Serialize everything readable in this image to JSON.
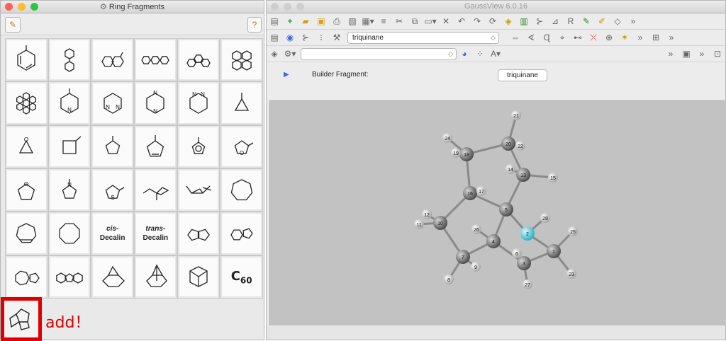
{
  "ring_window": {
    "title": "Ring Fragments",
    "tiles": [
      {
        "name": "benzene"
      },
      {
        "name": "biphenyl"
      },
      {
        "name": "naphthalene"
      },
      {
        "name": "anthracene"
      },
      {
        "name": "phenanthrene"
      },
      {
        "name": "pyrene"
      },
      {
        "name": "coronene"
      },
      {
        "name": "pyridine",
        "labels": [
          "N"
        ]
      },
      {
        "name": "pyrimidine",
        "labels": [
          "N",
          "N"
        ]
      },
      {
        "name": "pyrazine",
        "labels": [
          "N",
          "N"
        ]
      },
      {
        "name": "pyridazine",
        "labels": [
          "N",
          "N"
        ]
      },
      {
        "name": "cyclopropane"
      },
      {
        "name": "oxirane",
        "labels": [
          "O"
        ]
      },
      {
        "name": "cyclobutane"
      },
      {
        "name": "cyclopentane"
      },
      {
        "name": "cyclopentene"
      },
      {
        "name": "cyclopentadienyl"
      },
      {
        "name": "furan",
        "labels": [
          "O"
        ]
      },
      {
        "name": "tetrahydrofuran",
        "labels": [
          "O"
        ]
      },
      {
        "name": "pyrrole",
        "labels": [
          "N"
        ]
      },
      {
        "name": "thiophene",
        "labels": [
          "S"
        ]
      },
      {
        "name": "cyclohexane-chair"
      },
      {
        "name": "cyclohexane-boat"
      },
      {
        "name": "cycloheptane"
      },
      {
        "name": "cycloheptatriene"
      },
      {
        "name": "cyclooctane"
      },
      {
        "name": "cis-decalin",
        "text": [
          "cis-",
          "Decalin"
        ]
      },
      {
        "name": "trans-decalin",
        "text": [
          "trans-",
          "Decalin"
        ]
      },
      {
        "name": "pentalene"
      },
      {
        "name": "indene"
      },
      {
        "name": "azulene"
      },
      {
        "name": "fluorene"
      },
      {
        "name": "norbornene"
      },
      {
        "name": "norbornane"
      },
      {
        "name": "adamantane"
      },
      {
        "name": "c60",
        "text": [
          "C",
          "60"
        ]
      }
    ],
    "added_fragment": "triquinane",
    "add_label": "add！"
  },
  "gv_window": {
    "title": "GaussView 6.0.16",
    "fragment_combo": "triquinane",
    "builder_label": "Builder Fragment:",
    "builder_value": "triquinane",
    "overflow": "»"
  },
  "colors": {
    "close": "#ff5f57",
    "minimize": "#febc2e",
    "zoom": "#28c840",
    "highlight": "#e00000",
    "viewport": "#c2c2c2",
    "carbon": "#7a7a7a",
    "hetero": "#5fd0e0"
  },
  "molecule": {
    "atoms": [
      {
        "n": "1",
        "el": "C"
      },
      {
        "n": "2",
        "el": "X"
      },
      {
        "n": "3",
        "el": "C"
      },
      {
        "n": "4",
        "el": "C"
      },
      {
        "n": "5",
        "el": "C"
      },
      {
        "n": "6",
        "el": "H"
      },
      {
        "n": "7",
        "el": "C"
      },
      {
        "n": "8",
        "el": "H"
      },
      {
        "n": "9",
        "el": "H"
      },
      {
        "n": "10",
        "el": "C"
      },
      {
        "n": "11",
        "el": "H"
      },
      {
        "n": "12",
        "el": "H"
      },
      {
        "n": "13",
        "el": "C"
      },
      {
        "n": "14",
        "el": "H"
      },
      {
        "n": "15",
        "el": "H"
      },
      {
        "n": "16",
        "el": "C"
      },
      {
        "n": "17",
        "el": "H"
      },
      {
        "n": "18",
        "el": "C"
      },
      {
        "n": "19",
        "el": "H"
      },
      {
        "n": "20",
        "el": "C"
      },
      {
        "n": "21",
        "el": "H"
      },
      {
        "n": "22",
        "el": "H"
      },
      {
        "n": "23",
        "el": "H"
      },
      {
        "n": "24",
        "el": "H"
      },
      {
        "n": "25",
        "el": "H"
      },
      {
        "n": "26",
        "el": "H"
      },
      {
        "n": "27",
        "el": "H"
      },
      {
        "n": "28",
        "el": "H"
      }
    ]
  }
}
